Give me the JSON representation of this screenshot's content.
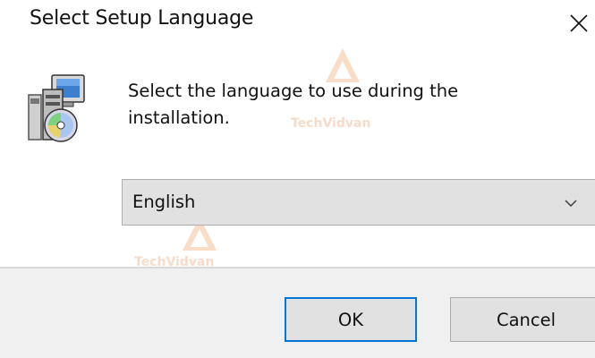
{
  "window": {
    "title": "Select Setup Language",
    "close_icon": "close-x-icon"
  },
  "body": {
    "icon": "setup-installer-icon",
    "message": "Select the language to use during the installation."
  },
  "language_select": {
    "selected": "English",
    "arrow_icon": "chevron-down-icon"
  },
  "buttons": {
    "ok_label": "OK",
    "cancel_label": "Cancel"
  },
  "watermark": {
    "text": "TechVidvan"
  },
  "colors": {
    "focus_border": "#0078d7",
    "button_face": "#e1e1e1",
    "footer_bg": "#f0f0f0"
  }
}
